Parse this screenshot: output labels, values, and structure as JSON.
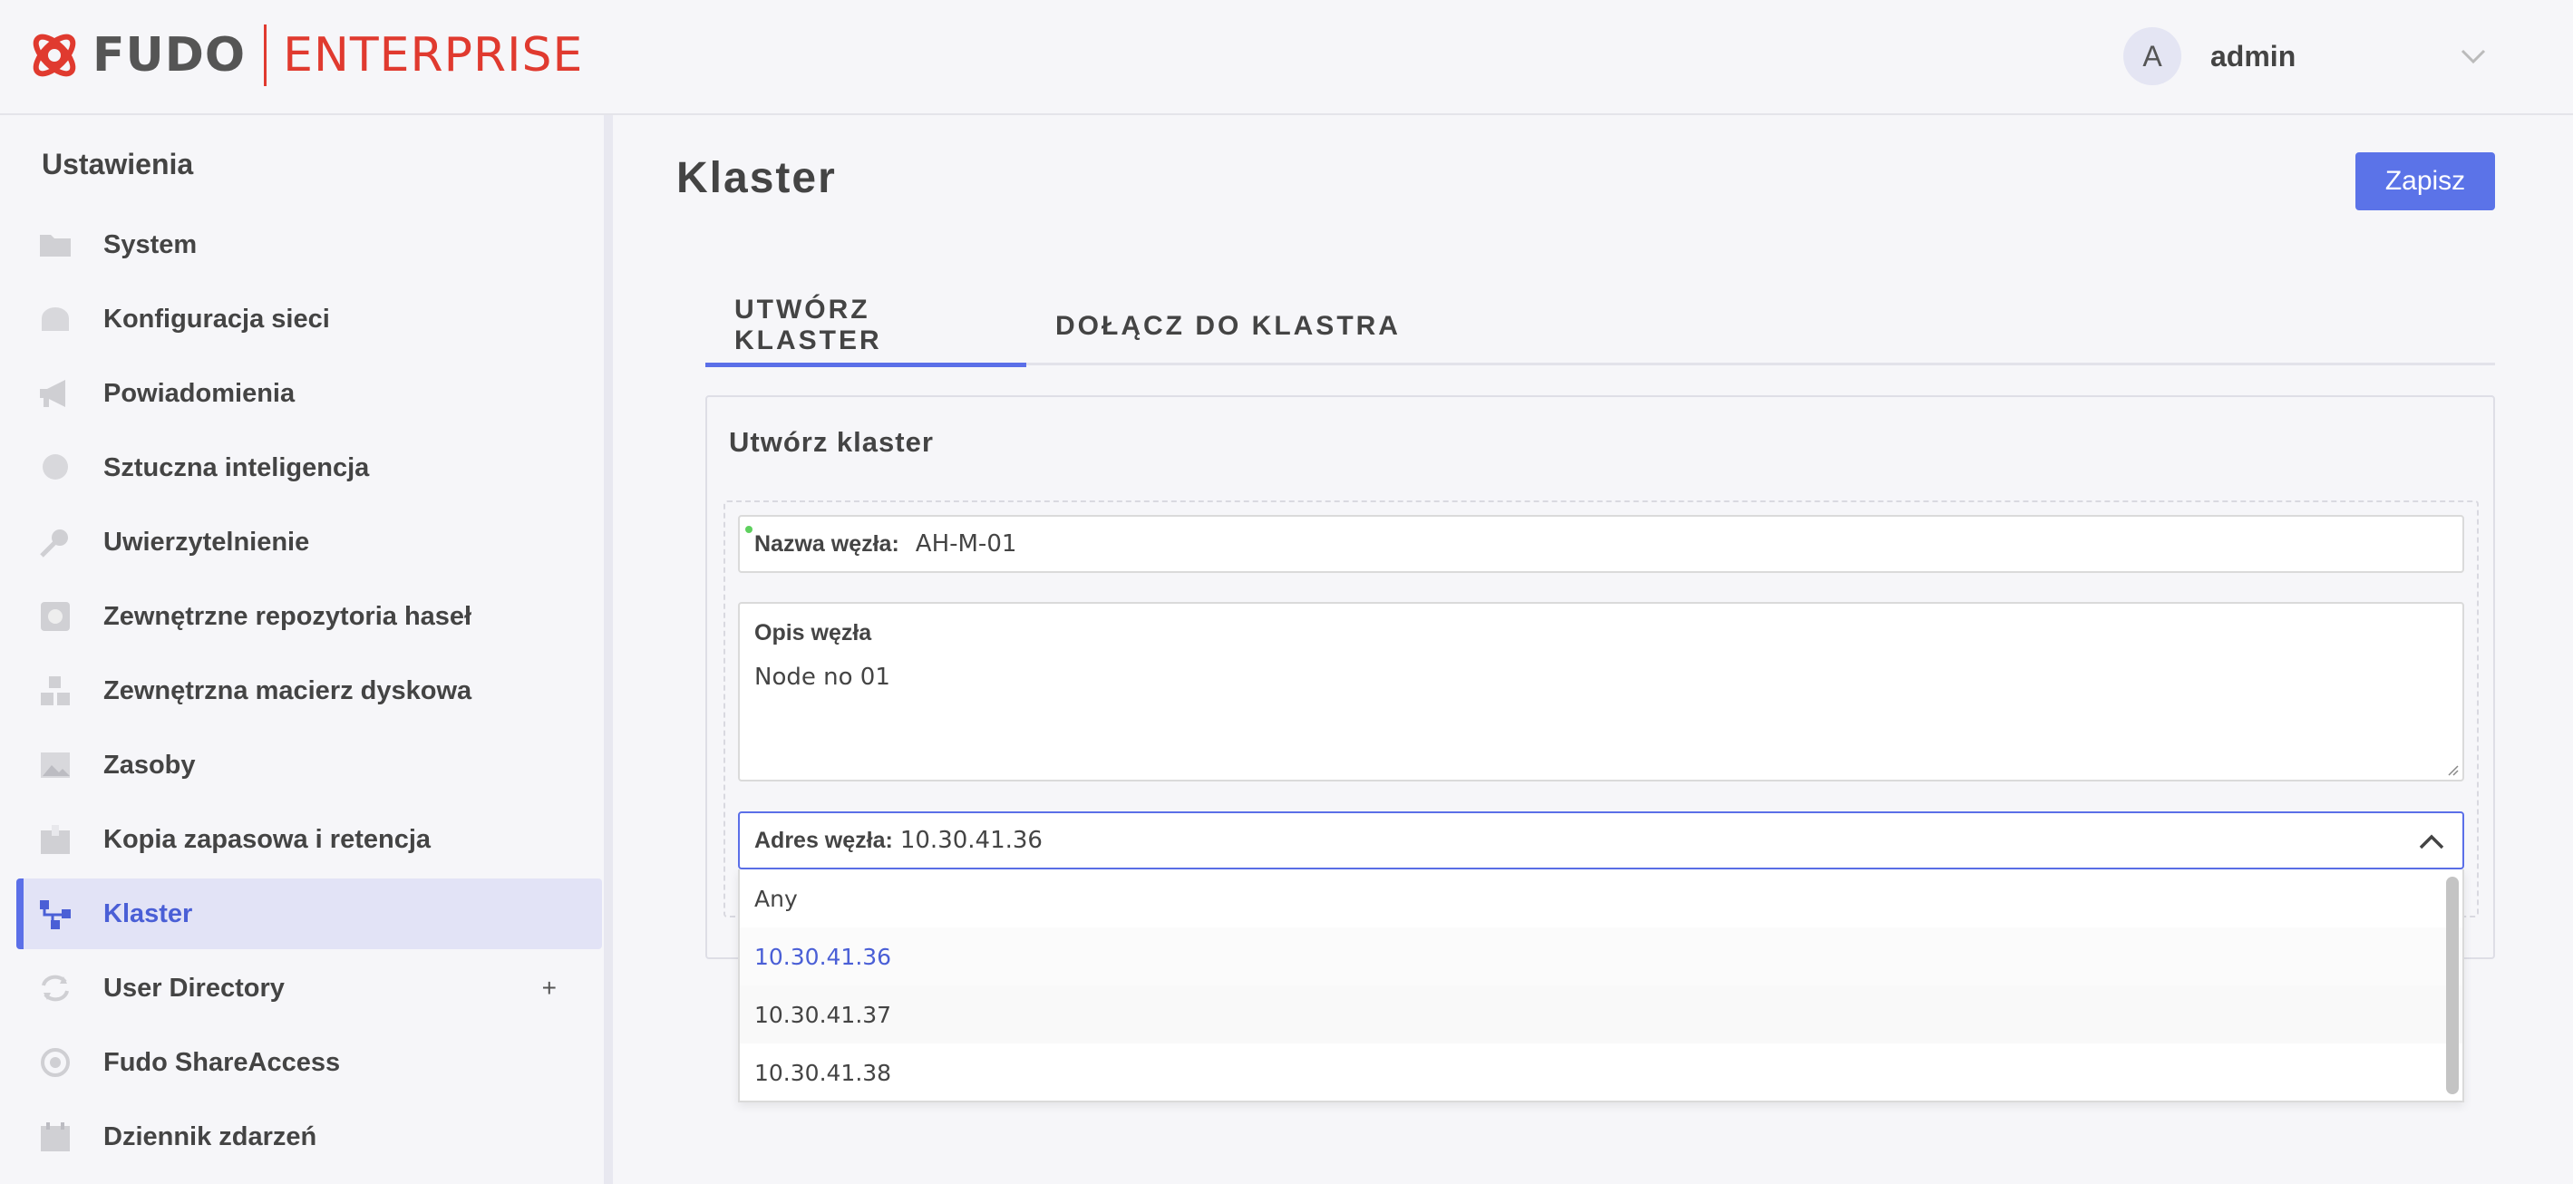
{
  "header": {
    "logo_brand": "FUDO",
    "logo_product": "ENTERPRISE",
    "avatar_initial": "A",
    "username": "admin"
  },
  "sidebar": {
    "title": "Ustawienia",
    "items": [
      {
        "label": "System",
        "icon": "folder-icon"
      },
      {
        "label": "Konfiguracja sieci",
        "icon": "network-icon"
      },
      {
        "label": "Powiadomienia",
        "icon": "megaphone-icon"
      },
      {
        "label": "Sztuczna inteligencja",
        "icon": "brain-icon"
      },
      {
        "label": "Uwierzytelnienie",
        "icon": "key-icon"
      },
      {
        "label": "Zewnętrzne repozytoria haseł",
        "icon": "vault-icon"
      },
      {
        "label": "Zewnętrzna macierz dyskowa",
        "icon": "boxes-icon"
      },
      {
        "label": "Zasoby",
        "icon": "image-icon"
      },
      {
        "label": "Kopia zapasowa i retencja",
        "icon": "archive-icon"
      },
      {
        "label": "Klaster",
        "icon": "cluster-icon",
        "active": true
      },
      {
        "label": "User Directory",
        "icon": "sync-icon",
        "expand": "+"
      },
      {
        "label": "Fudo ShareAccess",
        "icon": "share-icon"
      },
      {
        "label": "Dziennik zdarzeń",
        "icon": "calendar-icon"
      }
    ]
  },
  "main": {
    "title": "Klaster",
    "save_label": "Zapisz",
    "tabs": [
      {
        "label": "UTWÓRZ KLASTER",
        "active": true
      },
      {
        "label": "DOŁĄCZ DO KLASTRA",
        "active": false
      }
    ],
    "card_title": "Utwórz klaster",
    "node_name": {
      "label": "Nazwa węzła:",
      "value": "AH-M-01"
    },
    "node_desc": {
      "label": "Opis węzła",
      "value": "Node no 01"
    },
    "node_addr": {
      "label": "Adres węzła:",
      "value": "10.30.41.36",
      "options": [
        "Any",
        "10.30.41.36",
        "10.30.41.37",
        "10.30.41.38"
      ],
      "selected_index": 1
    }
  },
  "colors": {
    "accent": "#5b6fe8",
    "brand_red": "#e03a2f",
    "active_bg": "#e2e3f6"
  }
}
